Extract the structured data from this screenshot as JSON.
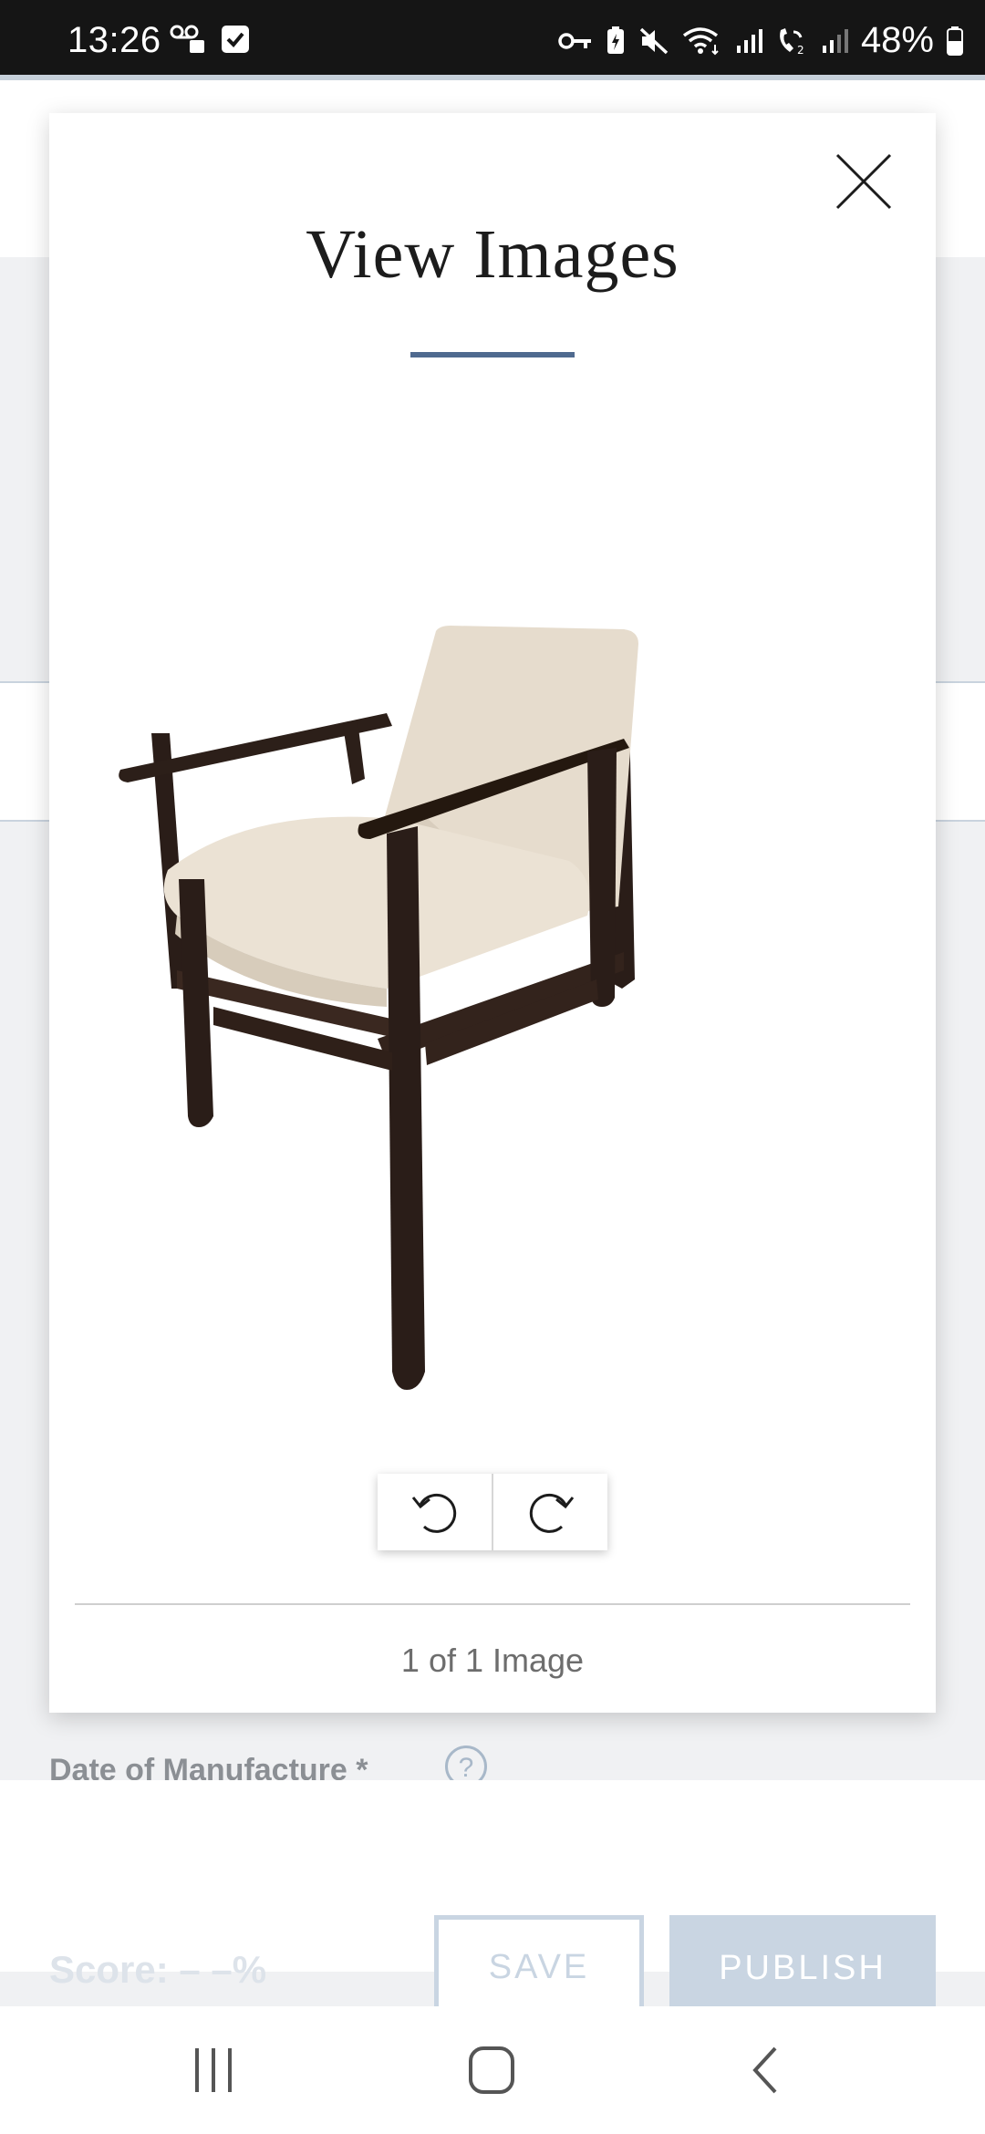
{
  "status_bar": {
    "time": "13:26",
    "battery_percent": "48%"
  },
  "background": {
    "date_label": "Date of Manufacture *",
    "help_icon": "?",
    "score_label": "Score: – –%",
    "save_label": "SAVE",
    "publish_label": "PUBLISH"
  },
  "modal": {
    "title": "View Images",
    "image_counter": "1 of 1 Image",
    "image_description": "photo-of-armchair",
    "accent_color": "#4f6a8f"
  },
  "icons": {
    "close": "close-icon",
    "rotate_left": "rotate-left-icon",
    "rotate_right": "rotate-right-icon",
    "nav_recents": "recents-icon",
    "nav_home": "home-icon",
    "nav_back": "back-icon"
  }
}
